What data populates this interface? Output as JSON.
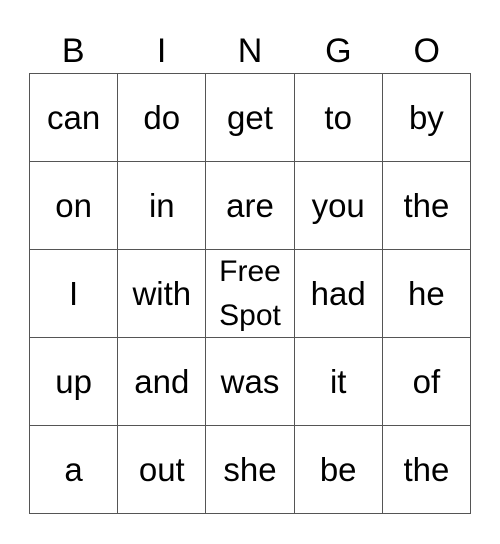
{
  "header": [
    "B",
    "I",
    "N",
    "G",
    "O"
  ],
  "rows": [
    [
      "can",
      "do",
      "get",
      "to",
      "by"
    ],
    [
      "on",
      "in",
      "are",
      "you",
      "the"
    ],
    [
      "I",
      "with",
      "Free Spot",
      "had",
      "he"
    ],
    [
      "up",
      "and",
      "was",
      "it",
      "of"
    ],
    [
      "a",
      "out",
      "she",
      "be",
      "the"
    ]
  ],
  "free_spot": {
    "line1": "Free",
    "line2": "Spot"
  }
}
